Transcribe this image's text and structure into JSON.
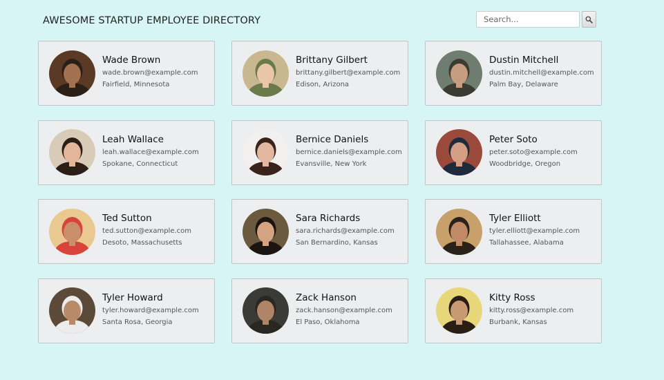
{
  "header": {
    "title": "AWESOME STARTUP EMPLOYEE DIRECTORY"
  },
  "search": {
    "placeholder": "Search...",
    "value": "",
    "button_icon": "magnifier-icon"
  },
  "employees": [
    {
      "name": "Wade Brown",
      "email": "wade.brown@example.com",
      "location": "Fairfield, Minnesota",
      "avatar_colors": [
        "#5a3a24",
        "#a27250",
        "#2b2018"
      ]
    },
    {
      "name": "Brittany Gilbert",
      "email": "brittany.gilbert@example.com",
      "location": "Edison, Arizona",
      "avatar_colors": [
        "#c9b78f",
        "#e9c6a8",
        "#6b7a4a"
      ]
    },
    {
      "name": "Dustin Mitchell",
      "email": "dustin.mitchell@example.com",
      "location": "Palm Bay, Delaware",
      "avatar_colors": [
        "#6f7d70",
        "#c79d82",
        "#3b3a33"
      ]
    },
    {
      "name": "Leah Wallace",
      "email": "leah.wallace@example.com",
      "location": "Spokane, Connecticut",
      "avatar_colors": [
        "#d8cbb8",
        "#e3b69a",
        "#2b1e16"
      ]
    },
    {
      "name": "Bernice Daniels",
      "email": "bernice.daniels@example.com",
      "location": "Evansville, New York",
      "avatar_colors": [
        "#f2f0ee",
        "#e2b9a0",
        "#3a231a"
      ]
    },
    {
      "name": "Peter Soto",
      "email": "peter.soto@example.com",
      "location": "Woodbridge, Oregon",
      "avatar_colors": [
        "#9a4a3a",
        "#d49e84",
        "#1f2a3c"
      ]
    },
    {
      "name": "Ted Sutton",
      "email": "ted.sutton@example.com",
      "location": "Desoto, Massachusetts",
      "avatar_colors": [
        "#e9c98f",
        "#c98f6c",
        "#d8443a"
      ]
    },
    {
      "name": "Sara Richards",
      "email": "sara.richards@example.com",
      "location": "San Bernardino, Kansas",
      "avatar_colors": [
        "#6b5a3e",
        "#d4a37f",
        "#1c1410"
      ]
    },
    {
      "name": "Tyler Elliott",
      "email": "tyler.elliott@example.com",
      "location": "Tallahassee, Alabama",
      "avatar_colors": [
        "#c7a06a",
        "#c08a66",
        "#2a2118"
      ]
    },
    {
      "name": "Tyler Howard",
      "email": "tyler.howard@example.com",
      "location": "Santa Rosa, Georgia",
      "avatar_colors": [
        "#5c4a38",
        "#b88a68",
        "#ececec"
      ]
    },
    {
      "name": "Zack Hanson",
      "email": "zack.hanson@example.com",
      "location": "El Paso, Oklahoma",
      "avatar_colors": [
        "#3a3a36",
        "#b08466",
        "#2a2622"
      ]
    },
    {
      "name": "Kitty Ross",
      "email": "kitty.ross@example.com",
      "location": "Burbank, Kansas",
      "avatar_colors": [
        "#e8d77a",
        "#c79a74",
        "#2a1d14"
      ]
    }
  ]
}
